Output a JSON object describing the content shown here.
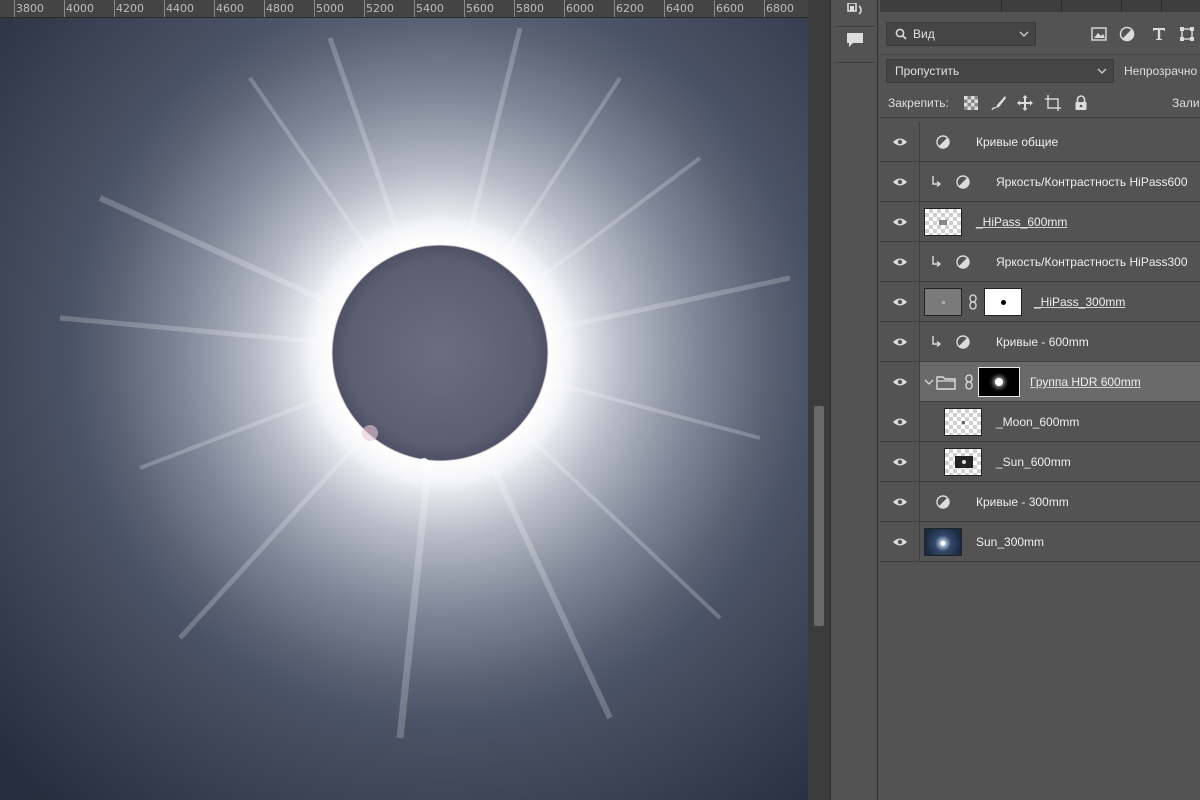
{
  "ruler": {
    "labels": [
      "3800",
      "4000",
      "4200",
      "4400",
      "4600",
      "4800",
      "5000",
      "5200",
      "5400",
      "5600",
      "5800",
      "6000",
      "6200",
      "6400",
      "6600",
      "6800"
    ]
  },
  "mid_strip": {
    "icons": [
      "adjust-history-icon",
      "comment-icon"
    ]
  },
  "layers_panel": {
    "filter": {
      "value": "Вид",
      "icons": [
        "image-filter-icon",
        "adjustment-filter-icon",
        "type-filter-icon",
        "shape-filter-icon"
      ]
    },
    "blend_mode": "Пропустить",
    "opacity_label": "Непрозрачно",
    "lock_label": "Закрепить:",
    "fill_label": "Зали",
    "layers": [
      {
        "name": "Кривые общие",
        "kind": "adjustment",
        "clipped": false,
        "visible": true
      },
      {
        "name": "Яркость/Контрастность HiPass600",
        "kind": "adjustment",
        "clipped": true,
        "visible": true
      },
      {
        "name": "_HiPass_600mm",
        "kind": "smart",
        "clipped": false,
        "visible": true
      },
      {
        "name": "Яркость/Контрастность HiPass300",
        "kind": "adjustment",
        "clipped": true,
        "visible": true
      },
      {
        "name": "_HiPass_300mm",
        "kind": "smart-masked",
        "clipped": false,
        "visible": true
      },
      {
        "name": "Кривые - 600mm",
        "kind": "adjustment",
        "clipped": true,
        "visible": true
      },
      {
        "name": "Группа HDR 600mm",
        "kind": "group",
        "clipped": false,
        "visible": true,
        "selected": true
      },
      {
        "name": "_Moon_600mm",
        "kind": "pixel-child",
        "clipped": false,
        "visible": true
      },
      {
        "name": "_Sun_600mm",
        "kind": "pixel-child",
        "clipped": false,
        "visible": true
      },
      {
        "name": "Кривые - 300mm",
        "kind": "adjustment",
        "clipped": false,
        "visible": true
      },
      {
        "name": "Sun_300mm",
        "kind": "pixel",
        "clipped": false,
        "visible": true
      }
    ]
  }
}
